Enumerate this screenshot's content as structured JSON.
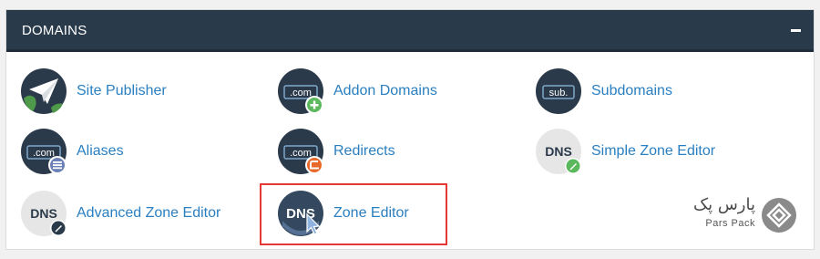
{
  "panel": {
    "title": "DOMAINS",
    "header_color": "#293a4a",
    "link_color": "#2a7fc0"
  },
  "items": [
    {
      "label": "Site Publisher",
      "icon": "paper-plane-icon"
    },
    {
      "label": "Addon Domains",
      "icon": "dot-com-plus-icon",
      "badge_text": ".com"
    },
    {
      "label": "Subdomains",
      "icon": "sub-icon",
      "badge_text": "sub."
    },
    {
      "label": "Aliases",
      "icon": "dot-com-list-icon",
      "badge_text": ".com"
    },
    {
      "label": "Redirects",
      "icon": "dot-com-redirect-icon",
      "badge_text": ".com"
    },
    {
      "label": "Simple Zone Editor",
      "icon": "dns-pencil-icon",
      "badge_text": "DNS"
    },
    {
      "label": "Advanced Zone Editor",
      "icon": "dns-pencil-dark-icon",
      "badge_text": "DNS"
    },
    {
      "label": "Zone Editor",
      "icon": "dns-cursor-icon",
      "badge_text": "DNS"
    }
  ],
  "highlight_color": "#e53935",
  "watermark": {
    "name_fa": "پارس پک",
    "name_en": "Pars Pack"
  }
}
